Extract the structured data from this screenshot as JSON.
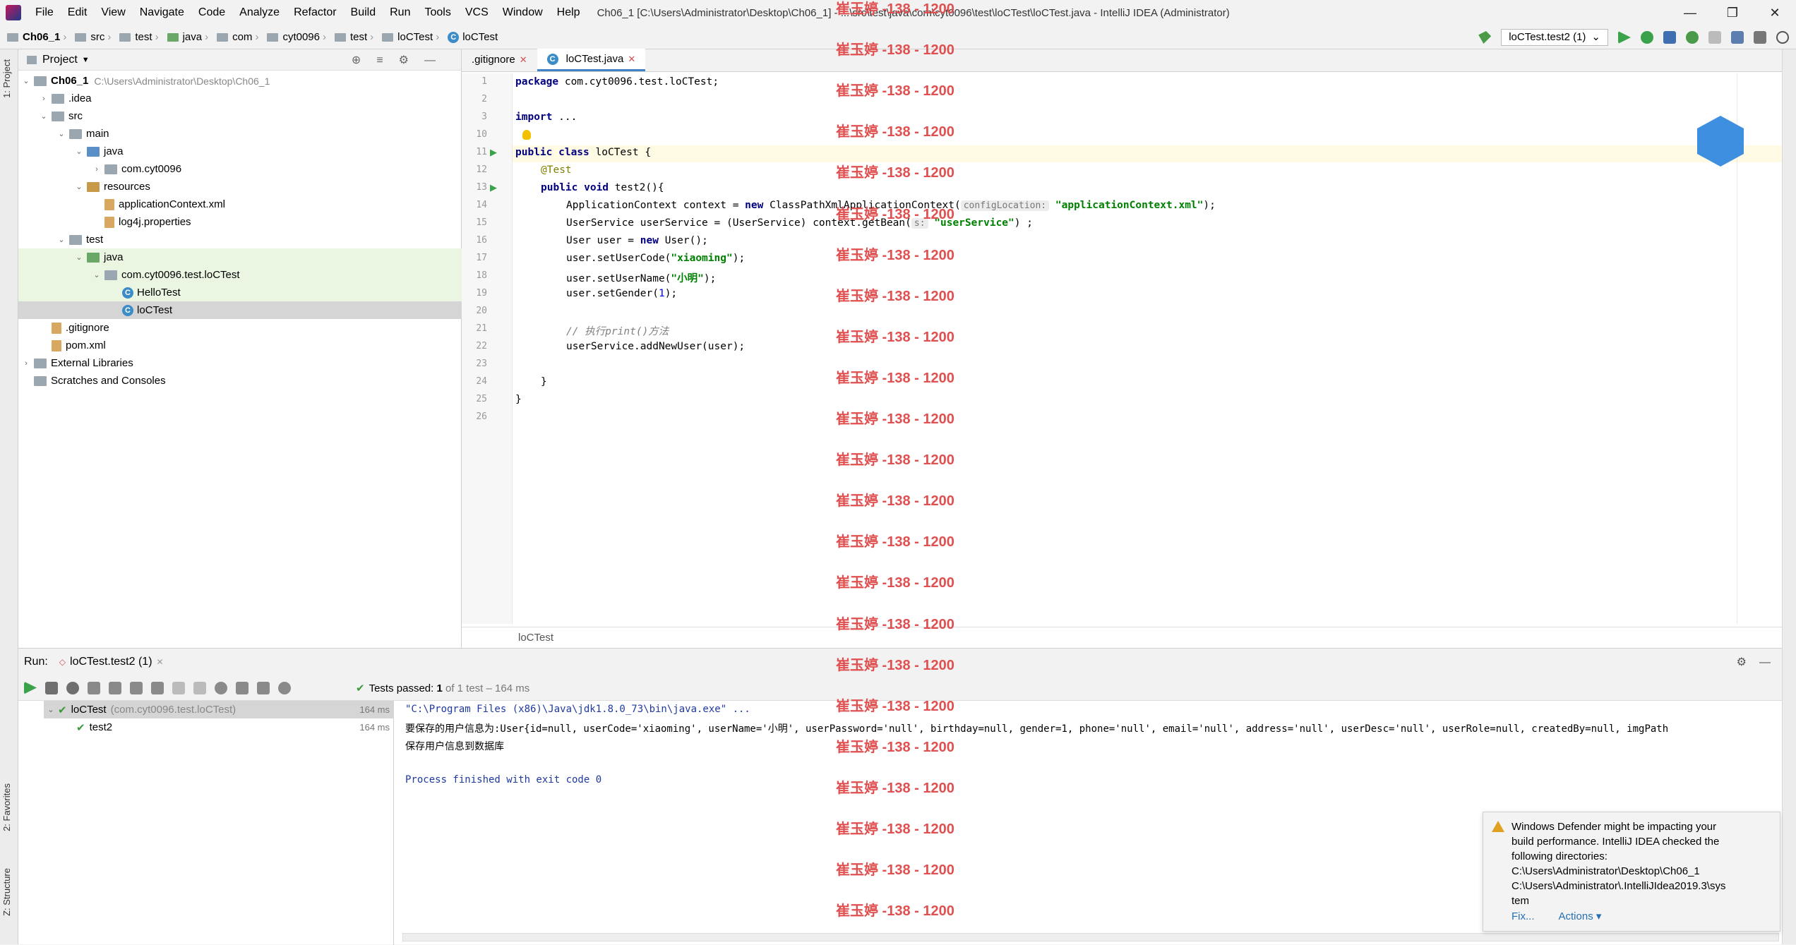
{
  "menu": {
    "items": [
      "File",
      "Edit",
      "View",
      "Navigate",
      "Code",
      "Analyze",
      "Refactor",
      "Build",
      "Run",
      "Tools",
      "VCS",
      "Window",
      "Help"
    ],
    "title": "Ch06_1 [C:\\Users\\Administrator\\Desktop\\Ch06_1] - ...\\src\\test\\java\\com\\cyt0096\\test\\loCTest\\loCTest.java - IntelliJ IDEA (Administrator)"
  },
  "window_controls": {
    "minimize": "—",
    "restore": "❐",
    "close": "✕"
  },
  "breadcrumb": [
    "Ch06_1",
    "src",
    "test",
    "java",
    "com",
    "cyt0096",
    "test",
    "loCTest",
    "loCTest"
  ],
  "run_config": {
    "label": "loCTest.test2 (1)"
  },
  "side_tabs": {
    "project": "1: Project",
    "favorites": "2: Favorites",
    "structure": "Z: Structure"
  },
  "project_panel": {
    "title": "Project",
    "tree": [
      {
        "label": "Ch06_1",
        "hint": "C:\\Users\\Administrator\\Desktop\\Ch06_1",
        "arrow": "⌄",
        "kind": "root"
      },
      {
        "label": ".idea",
        "arrow": "›",
        "kind": "folder"
      },
      {
        "label": "src",
        "arrow": "⌄",
        "kind": "folder"
      },
      {
        "label": "main",
        "arrow": "⌄",
        "kind": "folder"
      },
      {
        "label": "java",
        "arrow": "⌄",
        "kind": "src"
      },
      {
        "label": "com.cyt0096",
        "arrow": "›",
        "kind": "folder"
      },
      {
        "label": "resources",
        "arrow": "⌄",
        "kind": "res"
      },
      {
        "label": "applicationContext.xml",
        "arrow": "",
        "kind": "file"
      },
      {
        "label": "log4j.properties",
        "arrow": "",
        "kind": "file"
      },
      {
        "label": "test",
        "arrow": "⌄",
        "kind": "folder"
      },
      {
        "label": "java",
        "arrow": "⌄",
        "kind": "test"
      },
      {
        "label": "com.cyt0096.test.loCTest",
        "arrow": "⌄",
        "kind": "folder"
      },
      {
        "label": "HelloTest",
        "arrow": "",
        "kind": "class"
      },
      {
        "label": "loCTest",
        "arrow": "",
        "kind": "class"
      },
      {
        "label": ".gitignore",
        "arrow": "",
        "kind": "file"
      },
      {
        "label": "pom.xml",
        "arrow": "",
        "kind": "file"
      },
      {
        "label": "External Libraries",
        "arrow": "›",
        "kind": "lib"
      },
      {
        "label": "Scratches and Consoles",
        "arrow": "",
        "kind": "lib"
      }
    ]
  },
  "editor": {
    "tabs": [
      {
        "label": ".gitignore"
      },
      {
        "label": "loCTest.java",
        "active": true
      }
    ],
    "tab_close": "✕",
    "line_numbers": [
      "1",
      "2",
      "3",
      "10",
      "11",
      "12",
      "13",
      "14",
      "15",
      "16",
      "17",
      "18",
      "19",
      "20",
      "21",
      "22",
      "23",
      "24",
      "25",
      "26"
    ],
    "code": {
      "l1_kw": "package",
      "l1_rest": " com.cyt0096.test.loCTest;",
      "l3_kw": "import",
      "l3_rest": " ...",
      "l11_a": "public class ",
      "l11_b": "loCTest",
      " l11_c": " {",
      "l12": "@Test",
      "l13_a": "public void ",
      "l13_b": "test2(){",
      "l14_a": "ApplicationContext context = ",
      "l14_new": "new",
      " l14_b": " ClassPathXmlApplicationContext(",
      "l14_hint": "configLocation:",
      "l14_str": "\"applicationContext.xml\"",
      "l14_end": ");",
      "l15_a": "UserService userService = (UserService) context.getBean(",
      "l15_hint": "s:",
      "l15_str": "\"userService\"",
      "l15_end": ") ;",
      "l16_a": "User user = ",
      "l16_new": "new",
      "l16_b": " User();",
      "l17_a": "user.setUserCode(",
      "l17_str": "\"xiaoming\"",
      "l17_end": ");",
      "l18_a": "user.setUserName(",
      "l18_str": "\"小明\"",
      "l18_end": ");",
      "l19_a": "user.setGender(",
      "l19_num": "1",
      "l19_end": ");",
      "l21": "// 执行print()方法",
      "l22": "userService.addNewUser(user);",
      "l24": "}",
      "l25": "}"
    },
    "footer": "loCTest"
  },
  "watermark": "崔玉婷 -138 - 1200",
  "run": {
    "label": "Run:",
    "tab": "loCTest.test2 (1)",
    "status": "Tests passed:",
    "status_count": "1",
    "status_rest": "of 1 test – 164 ms",
    "tree": [
      {
        "label": "loCTest",
        "hint": "(com.cyt0096.test.loCTest)",
        "ms": "164 ms"
      },
      {
        "label": "test2",
        "ms": "164 ms"
      }
    ],
    "console": [
      "\"C:\\Program Files (x86)\\Java\\jdk1.8.0_73\\bin\\java.exe\" ...",
      "要保存的用户信息为:User{id=null, userCode='xiaoming', userName='小明', userPassword='null', birthday=null, gender=1, phone='null', email='null', address='null', userDesc='null', userRole=null, createdBy=null, imgPath",
      "保存用户信息到数据库",
      "",
      "Process finished with exit code 0"
    ]
  },
  "toast": {
    "lines": [
      "Windows Defender might be impacting your",
      "build performance. IntelliJ IDEA checked the",
      "following directories:",
      "C:\\Users\\Administrator\\Desktop\\Ch06_1",
      "C:\\Users\\Administrator\\.IntelliJIdea2019.3\\sys",
      "tem"
    ],
    "fix": "Fix...",
    "actions": "Actions ▾"
  }
}
